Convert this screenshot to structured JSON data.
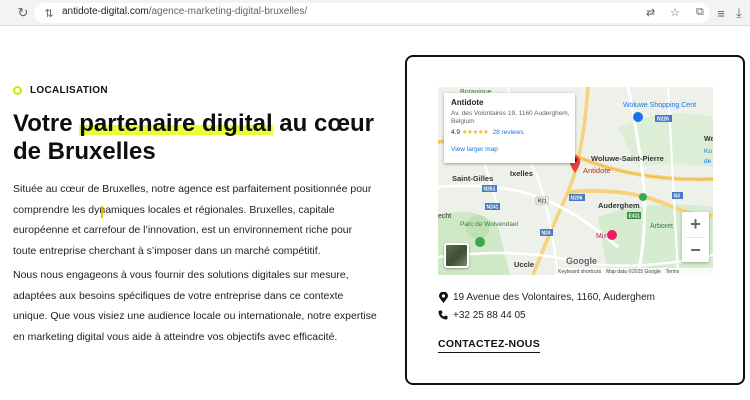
{
  "browser": {
    "url_domain": "antidote-digital.com",
    "url_path": "/agence-marketing-digital-bruxelles/"
  },
  "section": {
    "eyebrow": "LOCALISATION",
    "headline_before": "Votre ",
    "headline_highlight": "partenaire digital",
    "headline_after": " au cœur de Bruxelles",
    "paragraph1": "Située au cœur de Bruxelles, notre agence est parfaitement positionnée pour comprendre les dynamiques locales et régionales. Bruxelles, capitale européenne et carrefour de l’innovation, est un environnement riche pour toute entreprise cherchant à s’imposer dans un marché compétitif.",
    "paragraph2": "Nous nous engageons à vous fournir des solutions digitales sur mesure, adaptées aux besoins spécifiques de votre entreprise dans ce contexte unique. Que vous visiez une audience locale ou internationale, notre expertise en marketing digital vous aide à atteindre vos objectifs avec efficacité.",
    "accent_color": "#e8ff38"
  },
  "map": {
    "place_name": "Antidote",
    "address": "Av. des Volontaires 19, 1160 Auderghem, Belgium",
    "rating": "4.9",
    "stars": "★★★★★",
    "reviews": "28 reviews",
    "larger_map": "View larger map",
    "pin_label": "Antidote",
    "labels": {
      "botanique": "Botanique",
      "woluwe_shopping": "Woluwe Shopping Cent",
      "saint_gilles": "Saint-Gilles",
      "ixelles": "Ixelles",
      "woluwe_saint_pierre": "Woluwe-Saint-Pierre",
      "auderghem": "Auderghem",
      "echt": "echt",
      "parc": "Parc de Wolvendael",
      "mix": "Mix",
      "arboretum": "Arboret",
      "uccle": "Uccle",
      "we": "We",
      "ko": "Ko",
      "de": "de"
    },
    "roads": [
      "N226",
      "N261",
      "N241",
      "R21",
      "N206",
      "E411",
      "N24",
      "N3"
    ],
    "zoom_in": "+",
    "zoom_out": "−",
    "google": "Google",
    "attribution": [
      "Keyboard shortcuts",
      "Map data ©2025 Google",
      "Terms"
    ]
  },
  "contact": {
    "address": "19 Avenue des Volontaires, 1160, Auderghem",
    "phone": "+32 25 88 44 05",
    "cta": "CONTACTEZ-NOUS"
  }
}
